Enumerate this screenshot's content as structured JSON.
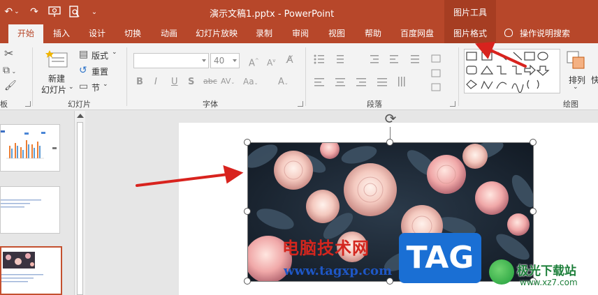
{
  "titlebar": {
    "window_title": "演示文稿1.pptx  -  PowerPoint",
    "context_title": "图片工具"
  },
  "tabs": [
    {
      "label": "开始"
    },
    {
      "label": "插入"
    },
    {
      "label": "设计"
    },
    {
      "label": "切换"
    },
    {
      "label": "动画"
    },
    {
      "label": "幻灯片放映"
    },
    {
      "label": "录制"
    },
    {
      "label": "审阅"
    },
    {
      "label": "视图"
    },
    {
      "label": "帮助"
    },
    {
      "label": "百度网盘"
    },
    {
      "label": "图片格式"
    }
  ],
  "tell_me": "操作说明搜索",
  "ribbon": {
    "clipboard_label": "板",
    "slides": {
      "new_slide_line1": "新建",
      "new_slide_line2": "幻灯片",
      "layout": "版式",
      "reset": "重置",
      "section": "节",
      "group_label": "幻灯片"
    },
    "font": {
      "font_name": "",
      "font_size": "40",
      "group_label": "字体"
    },
    "paragraph": {
      "group_label": "段落"
    },
    "drawing": {
      "arrange": "排列",
      "quick": "快",
      "group_label": "绘图"
    }
  },
  "watermark": {
    "brand_cn": "电脑技术网",
    "url": "www.tagxp.com",
    "tag": "TAG",
    "site2": "极光下载站",
    "site2_url": "www.xz7.com"
  },
  "colors": {
    "accent": "#b7472a",
    "arrow_red": "#d8231e"
  }
}
